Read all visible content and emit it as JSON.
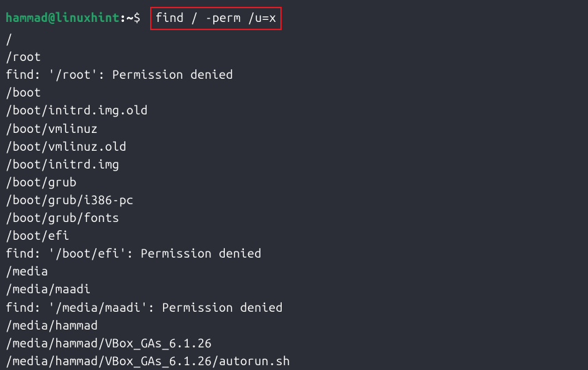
{
  "prompt": {
    "user": "hammad@linuxhint",
    "separator": ":",
    "path": "~",
    "symbol": "$"
  },
  "command": "find / -perm /u=x",
  "output": [
    "/",
    "/root",
    "find: '/root': Permission denied",
    "/boot",
    "/boot/initrd.img.old",
    "/boot/vmlinuz",
    "/boot/vmlinuz.old",
    "/boot/initrd.img",
    "/boot/grub",
    "/boot/grub/i386-pc",
    "/boot/grub/fonts",
    "/boot/efi",
    "find: '/boot/efi': Permission denied",
    "/media",
    "/media/maadi",
    "find: '/media/maadi': Permission denied",
    "/media/hammad",
    "/media/hammad/VBox_GAs_6.1.26",
    "/media/hammad/VBox_GAs_6.1.26/autorun.sh"
  ]
}
